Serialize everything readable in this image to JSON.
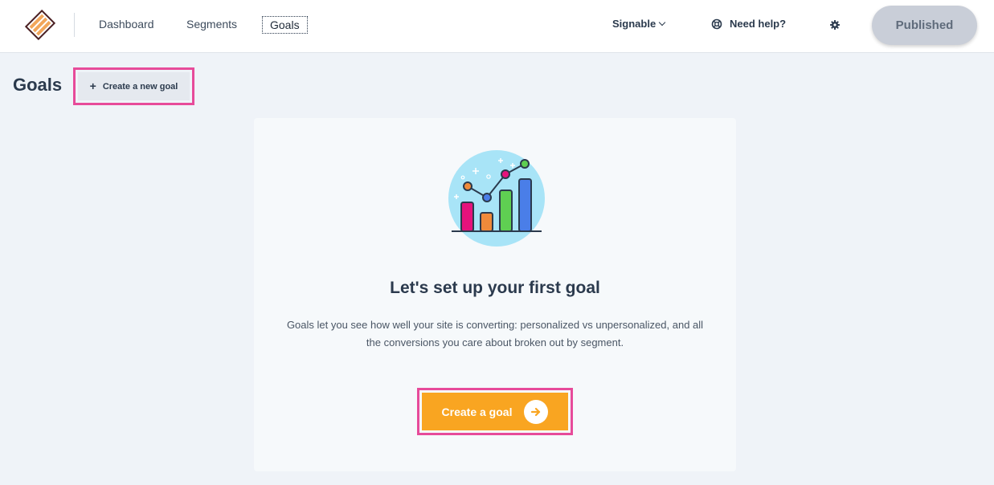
{
  "nav": {
    "items": [
      {
        "label": "Dashboard"
      },
      {
        "label": "Segments"
      },
      {
        "label": "Goals",
        "active": true
      }
    ],
    "account": "Signable",
    "help": "Need help?",
    "publish_status": "Published"
  },
  "page": {
    "title": "Goals",
    "new_goal_label": "Create a new goal"
  },
  "empty_state": {
    "title": "Let's set up your first goal",
    "description": "Goals let you see how well your site is converting: personalized vs unpersonalized, and all the conversions you care about broken out by segment.",
    "cta_label": "Create a goal"
  },
  "colors": {
    "highlight": "#e74b9a",
    "cta": "#f9a521",
    "published_bg": "#c9ced8"
  },
  "icons": [
    "logo-icon",
    "chevron-down-icon",
    "lifebuoy-icon",
    "gear-icon",
    "plus-icon",
    "chart-illustration",
    "arrow-right-icon"
  ]
}
